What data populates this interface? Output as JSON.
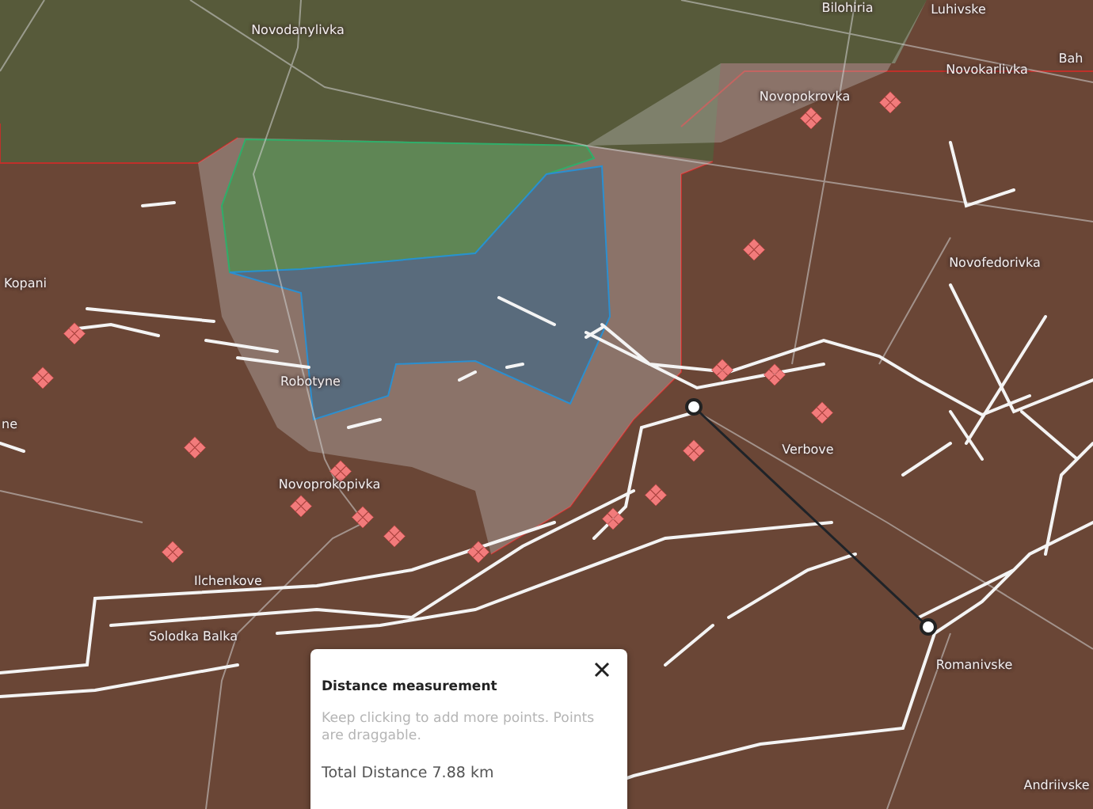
{
  "map": {
    "place_labels": [
      {
        "text": "Novodanylivka"
      },
      {
        "text": "Bilohiria"
      },
      {
        "text": "Luhivske"
      },
      {
        "text": "Bah"
      },
      {
        "text": "Novokarlivka"
      },
      {
        "text": "Novopokrovka"
      },
      {
        "text": "Novofedorivka"
      },
      {
        "text": "Kopani"
      },
      {
        "text": "Robotyne"
      },
      {
        "text": "ne"
      },
      {
        "text": "Novoprokopivka"
      },
      {
        "text": "Verbove"
      },
      {
        "text": "Ilchenkove"
      },
      {
        "text": "Solodka Balka"
      },
      {
        "text": "Romanivske"
      },
      {
        "text": "Andriivske"
      }
    ]
  },
  "measurement_popup": {
    "title": "Distance measurement",
    "hint": "Keep clicking to add more points. Points are draggable.",
    "total_distance": "Total Distance 7.88 km"
  }
}
